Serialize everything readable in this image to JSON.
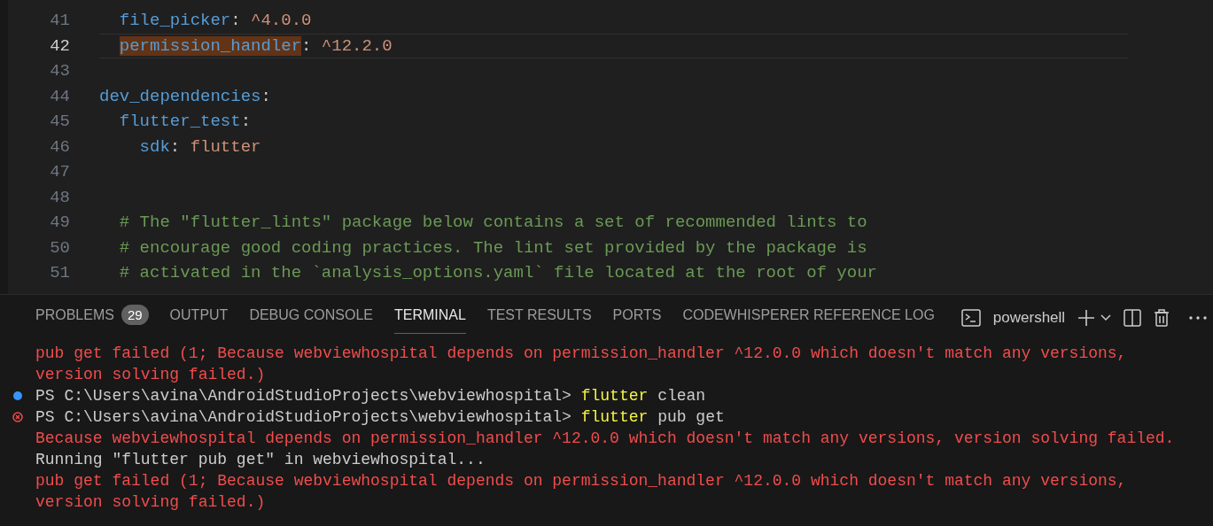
{
  "editor": {
    "lines": [
      {
        "number": "41",
        "current": false,
        "segments": [
          {
            "kind": "key",
            "text": "  file_picker",
            "highlighted": false
          },
          {
            "kind": "punct",
            "text": ": ",
            "highlighted": false
          },
          {
            "kind": "value",
            "text": "^4.0.0",
            "highlighted": false
          }
        ]
      },
      {
        "number": "42",
        "current": true,
        "segments": [
          {
            "kind": "key",
            "text": "  permission_handler",
            "highlighted": true
          },
          {
            "kind": "punct",
            "text": ": ",
            "highlighted": false
          },
          {
            "kind": "value",
            "text": "^12.2.0",
            "highlighted": false
          }
        ]
      },
      {
        "number": "43",
        "current": false
      },
      {
        "number": "44",
        "current": false,
        "segments": [
          {
            "kind": "key",
            "text": "dev_dependencies",
            "highlighted": false
          },
          {
            "kind": "punct",
            "text": ":",
            "highlighted": false
          }
        ]
      },
      {
        "number": "45",
        "current": false,
        "segments": [
          {
            "kind": "key",
            "text": "  flutter_test",
            "highlighted": false
          },
          {
            "kind": "punct",
            "text": ":",
            "highlighted": false
          }
        ]
      },
      {
        "number": "46",
        "current": false,
        "segments": [
          {
            "kind": "key",
            "text": "    sdk",
            "highlighted": false
          },
          {
            "kind": "punct",
            "text": ": ",
            "highlighted": false
          },
          {
            "kind": "value",
            "text": "flutter",
            "highlighted": false
          }
        ]
      },
      {
        "number": "47",
        "current": false
      },
      {
        "number": "48",
        "current": false
      },
      {
        "number": "49",
        "current": false,
        "segments": [
          {
            "kind": "comment",
            "text": "  # The \"flutter_lints\" package below contains a set of recommended lints to",
            "highlighted": false
          }
        ]
      },
      {
        "number": "50",
        "current": false,
        "segments": [
          {
            "kind": "comment",
            "text": "  # encourage good coding practices. The lint set provided by the package is",
            "highlighted": false
          }
        ]
      },
      {
        "number": "51",
        "current": false,
        "segments": [
          {
            "kind": "comment",
            "text": "  # activated in the `analysis_options.yaml` file located at the root of your",
            "highlighted": false
          }
        ]
      }
    ]
  },
  "panel": {
    "tabs": [
      {
        "label": "PROBLEMS",
        "selected": false,
        "badge": "29"
      },
      {
        "label": "OUTPUT",
        "selected": false
      },
      {
        "label": "DEBUG CONSOLE",
        "selected": false
      },
      {
        "label": "TERMINAL",
        "selected": true
      },
      {
        "label": "TEST RESULTS",
        "selected": false
      },
      {
        "label": "PORTS",
        "selected": false
      },
      {
        "label": "CODEWHISPERER REFERENCE LOG",
        "selected": false
      }
    ],
    "shell": "powershell",
    "terminal": [
      {
        "kind": "output",
        "segments": [
          {
            "kind": "error",
            "text": "pub get failed (1; Because webviewhospital depends on permission_handler ^12.0.0 which doesn't match any versions,"
          }
        ]
      },
      {
        "kind": "output",
        "segments": [
          {
            "kind": "error",
            "text": "version solving failed.)"
          }
        ]
      },
      {
        "kind": "success",
        "segments": [
          {
            "kind": "prompt",
            "text": "PS C:\\Users\\avina\\AndroidStudioProjects\\webviewhospital> "
          },
          {
            "kind": "command",
            "text": "flutter"
          },
          {
            "kind": "prompt",
            "text": " clean"
          }
        ]
      },
      {
        "kind": "failure",
        "segments": [
          {
            "kind": "prompt",
            "text": "PS C:\\Users\\avina\\AndroidStudioProjects\\webviewhospital> "
          },
          {
            "kind": "command",
            "text": "flutter"
          },
          {
            "kind": "prompt",
            "text": " pub get"
          }
        ]
      },
      {
        "kind": "output",
        "segments": [
          {
            "kind": "error",
            "text": "Because webviewhospital depends on permission_handler ^12.0.0 which doesn't match any versions, version solving failed."
          }
        ]
      },
      {
        "kind": "output",
        "segments": [
          {
            "kind": "prompt",
            "text": "Running \"flutter pub get\" in webviewhospital..."
          }
        ]
      },
      {
        "kind": "output",
        "segments": [
          {
            "kind": "error",
            "text": "pub get failed (1; Because webviewhospital depends on permission_handler ^12.0.0 which doesn't match any versions,"
          }
        ]
      },
      {
        "kind": "output",
        "segments": [
          {
            "kind": "error",
            "text": "version solving failed.)"
          }
        ]
      }
    ]
  }
}
